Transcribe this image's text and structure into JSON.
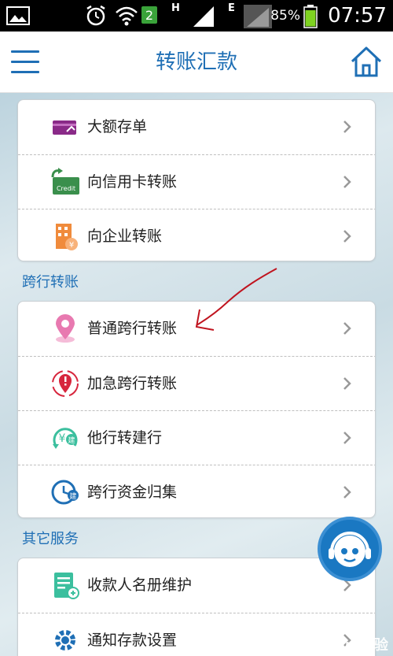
{
  "status_bar": {
    "sim_number": "2",
    "network_h": "H",
    "network_e": "E",
    "battery": "85%",
    "time": "07:57"
  },
  "header": {
    "title": "转账汇款",
    "menu_icon": "hamburger-menu-icon",
    "home_icon": "home-icon"
  },
  "top_group": {
    "items": [
      {
        "label": "大额存单",
        "icon": "certificate-card-icon"
      },
      {
        "label": "向信用卡转账",
        "icon": "credit-card-icon",
        "icon_text": "Credit"
      },
      {
        "label": "向企业转账",
        "icon": "building-icon"
      }
    ]
  },
  "interbank": {
    "section_title": "跨行转账",
    "items": [
      {
        "label": "普通跨行转账",
        "icon": "location-pin-icon"
      },
      {
        "label": "加急跨行转账",
        "icon": "urgent-pin-icon"
      },
      {
        "label": "他行转建行",
        "icon": "yuan-transfer-icon",
        "icon_text": "建"
      },
      {
        "label": "跨行资金归集",
        "icon": "clock-collect-icon",
        "icon_text": "建"
      }
    ]
  },
  "other": {
    "section_title": "其它服务",
    "items": [
      {
        "label": "收款人名册维护",
        "icon": "payee-list-icon"
      },
      {
        "label": "通知存款设置",
        "icon": "gear-icon"
      }
    ]
  },
  "colors": {
    "brand_blue": "#1f6fb5",
    "accent_purple": "#8a2a88",
    "accent_green": "#3a8f4c",
    "accent_orange": "#f08b3c",
    "accent_pink": "#e879b0",
    "accent_red": "#d7263d",
    "accent_teal": "#3bbf9e"
  },
  "watermark": "Baidu 经验"
}
